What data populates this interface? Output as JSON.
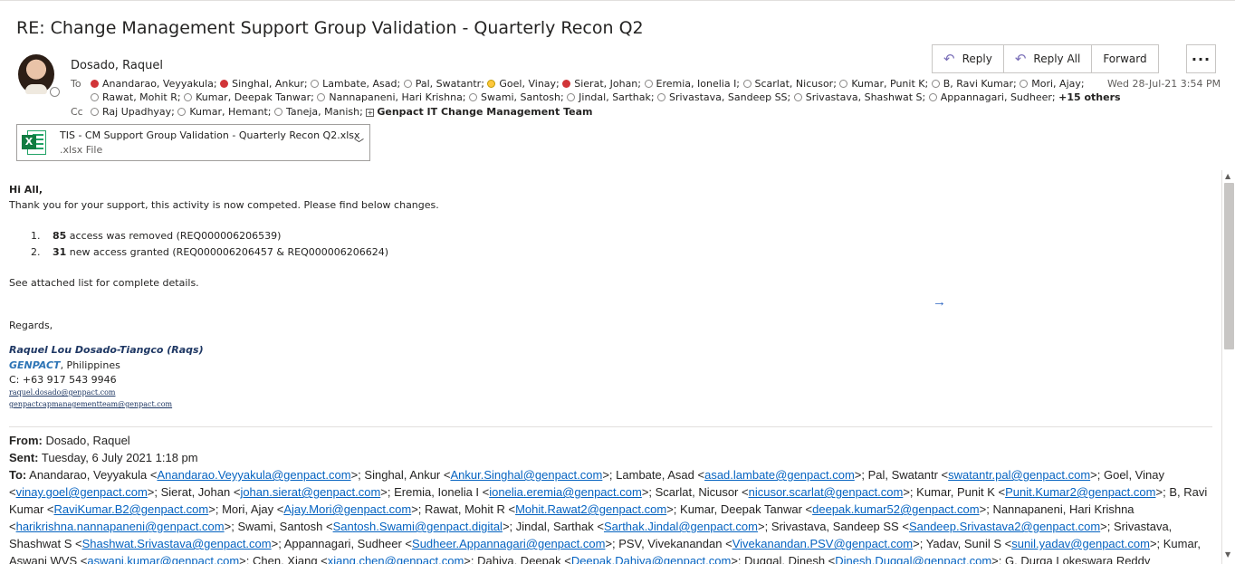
{
  "subject": "RE: Change Management Support Group Validation - Quarterly Recon Q2",
  "sender": "Dosado, Raquel",
  "to_label": "To",
  "cc_label": "Cc",
  "to_line1": [
    {
      "name": "Anandarao, Veyyakula;",
      "status": "red"
    },
    {
      "name": "Singhal, Ankur;",
      "status": "red"
    },
    {
      "name": "Lambate, Asad;",
      "status": "empty"
    },
    {
      "name": "Pal, Swatantr;",
      "status": "empty"
    },
    {
      "name": "Goel, Vinay;",
      "status": "yellow"
    },
    {
      "name": "Sierat, Johan;",
      "status": "red"
    },
    {
      "name": "Eremia, Ionelia I;",
      "status": "empty"
    },
    {
      "name": "Scarlat, Nicusor;",
      "status": "empty"
    },
    {
      "name": "Kumar, Punit K;",
      "status": "empty"
    },
    {
      "name": "B, Ravi Kumar;",
      "status": "empty"
    },
    {
      "name": "Mori, Ajay;",
      "status": "empty"
    }
  ],
  "to_line2": [
    {
      "name": "Rawat, Mohit R;",
      "status": "empty"
    },
    {
      "name": "Kumar, Deepak Tanwar;",
      "status": "empty"
    },
    {
      "name": "Nannapaneni, Hari Krishna;",
      "status": "empty"
    },
    {
      "name": "Swami, Santosh;",
      "status": "empty"
    },
    {
      "name": "Jindal, Sarthak;",
      "status": "empty"
    },
    {
      "name": "Srivastava, Sandeep SS;",
      "status": "empty"
    },
    {
      "name": "Srivastava, Shashwat S;",
      "status": "empty"
    },
    {
      "name": "Appannagari, Sudheer;",
      "status": "empty"
    }
  ],
  "to_more": "+15 others",
  "cc_list": [
    {
      "name": "Raj Upadhyay;",
      "status": "empty"
    },
    {
      "name": "Kumar, Hemant;",
      "status": "empty"
    },
    {
      "name": "Taneja, Manish;",
      "status": "empty"
    }
  ],
  "cc_group": "Genpact IT Change Management Team",
  "actions": {
    "reply": "Reply",
    "reply_all": "Reply All",
    "forward": "Forward",
    "more": "···"
  },
  "date": "Wed 28-Jul-21 3:54 PM",
  "attachment": {
    "name": "TIS - CM Support Group Validation - Quarterly Recon Q2.xlsx",
    "type": ".xlsx File"
  },
  "body": {
    "greeting": "Hi All,",
    "intro": "Thank you for your support, this activity is now competed. Please find below changes.",
    "items": [
      {
        "num": "1.",
        "count": "85",
        "text": " access was removed (REQ000006206539)"
      },
      {
        "num": "2.",
        "count": "31",
        "text": " new access granted (REQ000006206457 & REQ000006206624)"
      }
    ],
    "details": "See attached list for complete details.",
    "regards": "Regards,",
    "sig_name": "Raquel Lou Dosado-Tiangco (Raqs)",
    "sig_company": "GENPACT",
    "sig_country": ", Philippines",
    "sig_phone": "C: +63 917 543 9946",
    "sig_email1": "raquel.dosado@genpact.com",
    "sig_email2": "genpactcapmanagementteam@genpact.com"
  },
  "forwarded": {
    "from_label": "From:",
    "from": " Dosado, Raquel",
    "sent_label": "Sent:",
    "sent": " Tuesday, 6 July 2021 1:18 pm",
    "to_label": "To:",
    "to_entries": [
      {
        "name": "Anandarao, Veyyakula",
        "email": "Anandarao.Veyyakula@genpact.com"
      },
      {
        "name": "Singhal, Ankur",
        "email": "Ankur.Singhal@genpact.com"
      },
      {
        "name": "Lambate, Asad",
        "email": "asad.lambate@genpact.com"
      },
      {
        "name": "Pal, Swatantr",
        "email": "swatantr.pal@genpact.com"
      },
      {
        "name": "Goel, Vinay",
        "email": "vinay.goel@genpact.com"
      },
      {
        "name": "Sierat, Johan",
        "email": "johan.sierat@genpact.com"
      },
      {
        "name": "Eremia, Ionelia I",
        "email": "ionelia.eremia@genpact.com"
      },
      {
        "name": "Scarlat, Nicusor",
        "email": "nicusor.scarlat@genpact.com"
      },
      {
        "name": "Kumar, Punit K",
        "email": "Punit.Kumar2@genpact.com"
      },
      {
        "name": "B, Ravi Kumar",
        "email": "RaviKumar.B2@genpact.com"
      },
      {
        "name": "Mori, Ajay",
        "email": "Ajay.Mori@genpact.com"
      },
      {
        "name": "Rawat, Mohit R",
        "email": "Mohit.Rawat2@genpact.com"
      },
      {
        "name": "Kumar, Deepak Tanwar",
        "email": "deepak.kumar52@genpact.com"
      },
      {
        "name": "Nannapaneni, Hari Krishna",
        "email": "harikrishna.nannapaneni@genpact.com"
      },
      {
        "name": "Swami, Santosh",
        "email": "Santosh.Swami@genpact.digital"
      },
      {
        "name": "Jindal, Sarthak",
        "email": "Sarthak.Jindal@genpact.com"
      },
      {
        "name": "Srivastava, Sandeep SS",
        "email": "Sandeep.Srivastava2@genpact.com"
      },
      {
        "name": "Srivastava, Shashwat S",
        "email": "Shashwat.Srivastava@genpact.com"
      },
      {
        "name": "Appannagari, Sudheer",
        "email": "Sudheer.Appannagari@genpact.com"
      },
      {
        "name": "PSV, Vivekanandan",
        "email": "Vivekanandan.PSV@genpact.com"
      },
      {
        "name": "Yadav, Sunil S",
        "email": "sunil.yadav@genpact.com"
      },
      {
        "name": "Kumar, Aswani WVS",
        "email": "aswani.kumar@genpact.com"
      },
      {
        "name": "Chen, Xiang",
        "email": "xiang.chen@genpact.com"
      },
      {
        "name": "Dahiya, Deepak",
        "email": "Deepak.Dahiya@genpact.com"
      },
      {
        "name": "Duggal, Dinesh",
        "email": "Dinesh.Duggal@genpact.com"
      },
      {
        "name": "G, Durga Lokeswara Reddy",
        "email": ""
      }
    ]
  },
  "colors": {
    "accent": "#0563c1",
    "presence_red": "#d13438",
    "presence_yellow": "#ffc83d",
    "excel_green": "#107c41",
    "signature_blue": "#1f3864"
  }
}
